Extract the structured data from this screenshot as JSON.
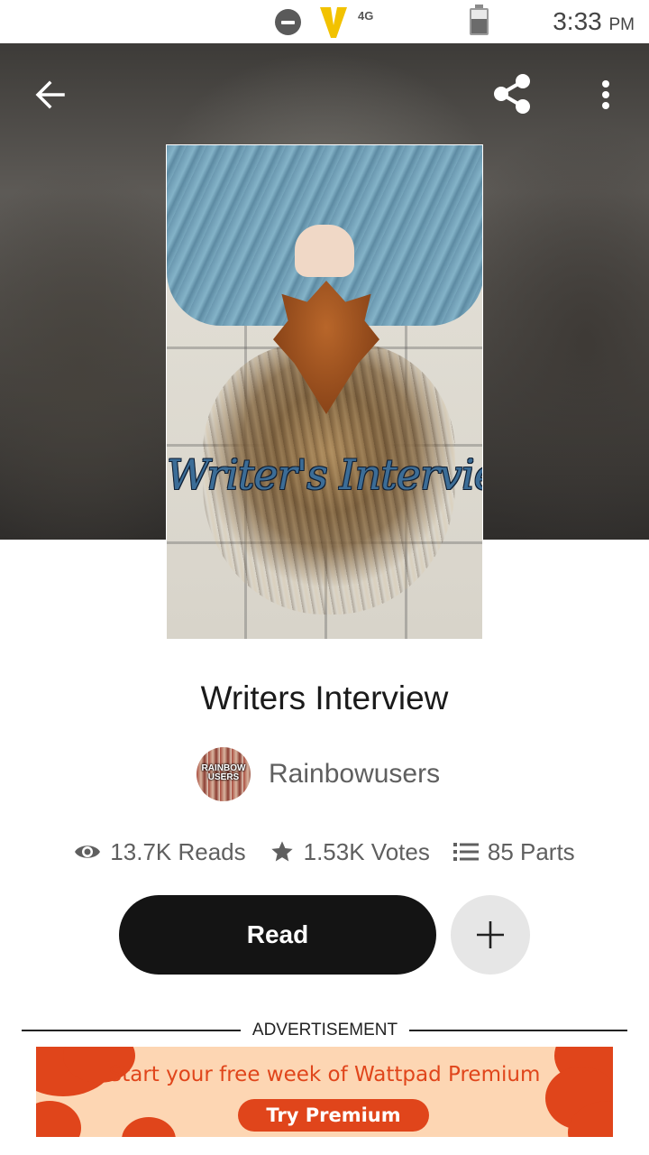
{
  "status_bar": {
    "network": "4G",
    "time": "3:33",
    "ampm": "PM",
    "icons": [
      "do-not-disturb-icon",
      "carrier-icon",
      "battery-icon"
    ]
  },
  "header": {
    "icons": [
      "back-arrow-icon",
      "share-icon",
      "more-vert-icon"
    ]
  },
  "cover": {
    "title_text": "Writer's Interviews"
  },
  "story": {
    "title": "Writers Interview",
    "author": {
      "name": "Rainbowusers",
      "avatar_text": "RAINBOW USERS"
    },
    "stats": {
      "reads": "13.7K Reads",
      "votes": "1.53K Votes",
      "parts": "85 Parts"
    }
  },
  "actions": {
    "read_label": "Read",
    "add_icon": "plus-icon"
  },
  "ad": {
    "label": "ADVERTISEMENT",
    "headline": "Start your free week of Wattpad Premium",
    "cta": "Try Premium"
  },
  "colors": {
    "ad_accent": "#e0451b",
    "ad_background": "#fdd6b3",
    "read_button": "#141414",
    "add_button": "#e6e6e6"
  }
}
